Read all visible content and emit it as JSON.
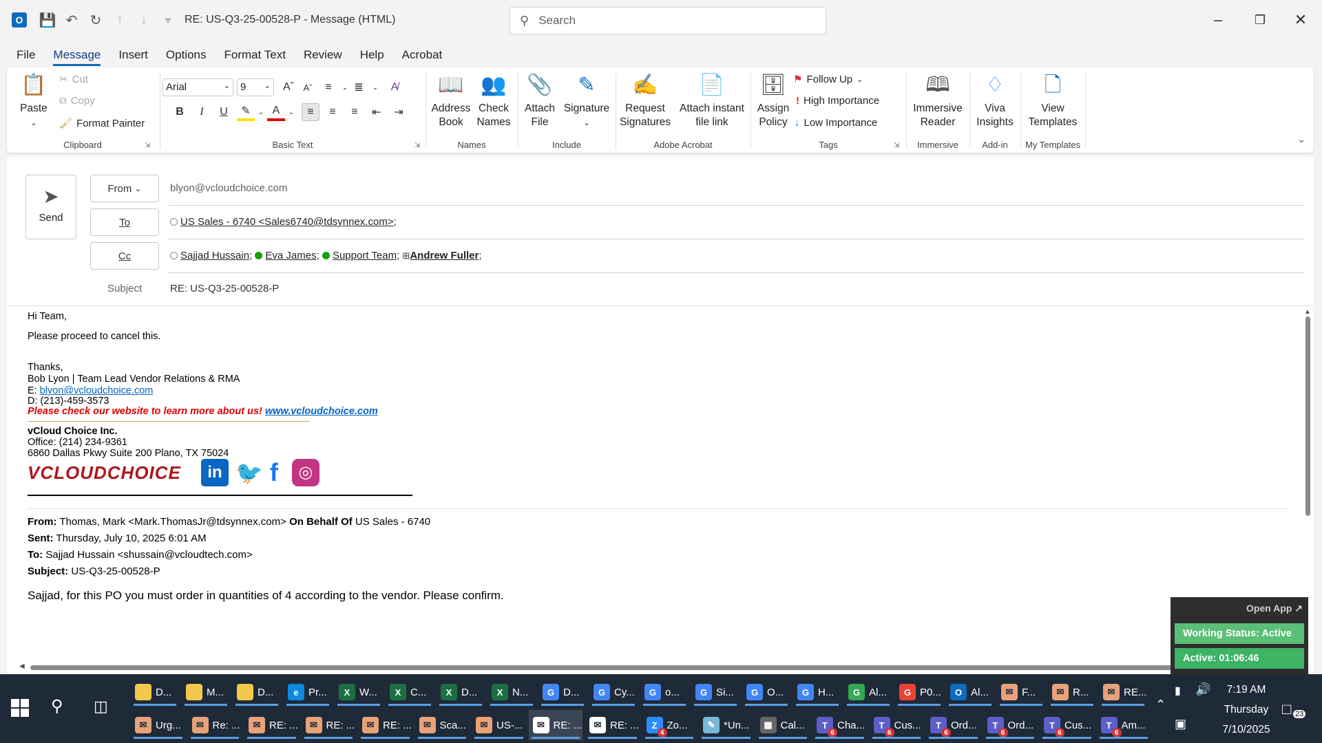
{
  "window": {
    "title": "RE: US-Q3-25-00528-P  -  Message (HTML)",
    "search_placeholder": "Search"
  },
  "menu": [
    "File",
    "Message",
    "Insert",
    "Options",
    "Format Text",
    "Review",
    "Help",
    "Acrobat"
  ],
  "ribbon": {
    "clipboard": {
      "paste": "Paste",
      "cut": "Cut",
      "copy": "Copy",
      "format_painter": "Format Painter",
      "label": "Clipboard"
    },
    "basic_text": {
      "font": "Arial",
      "size": "9",
      "label": "Basic Text"
    },
    "names": {
      "address_book": "Address Book",
      "check_names": "Check Names",
      "label": "Names"
    },
    "include": {
      "attach_file": "Attach File",
      "signature": "Signature",
      "label": "Include"
    },
    "adobe": {
      "request_signatures": "Request Signatures",
      "attach_link": "Attach instant file link",
      "label": "Adobe Acrobat"
    },
    "tags": {
      "assign_policy": "Assign Policy",
      "follow_up": "Follow Up",
      "high": "High Importance",
      "low": "Low Importance",
      "label": "Tags"
    },
    "immersive": {
      "reader": "Immersive Reader",
      "label": "Immersive"
    },
    "addin": {
      "viva": "Viva Insights",
      "label": "Add-in"
    },
    "templates": {
      "view": "View Templates",
      "label": "My Templates"
    }
  },
  "compose": {
    "send": "Send",
    "from_btn": "From",
    "from_value": "blyon@vcloudchoice.com",
    "to_btn": "To",
    "to_value": "US Sales - 6740 <Sales6740@tdsynnex.com>",
    "cc_btn": "Cc",
    "cc": [
      "Sajjad Hussain",
      "Eva James",
      "Support Team",
      "Andrew Fuller"
    ],
    "subject_label": "Subject",
    "subject_value": "RE: US-Q3-25-00528-P"
  },
  "body": {
    "greeting": "Hi Team,",
    "line1": "Please proceed to cancel this.",
    "thanks": "Thanks,",
    "sig_name": "Bob Lyon | Team Lead Vendor Relations & RMA",
    "sig_email_prefix": "E: ",
    "sig_email": "blyon@vcloudchoice.com",
    "sig_phone": "D: (213)-459-3573",
    "promo": "Please check our website to learn more about us!",
    "promo_link": "www.vcloudchoice.com",
    "company": "vCloud Choice Inc.",
    "office": "Office: (214) 234-9361",
    "address": "6860 Dallas Pkwy Suite 200 Plano, TX 75024",
    "logo_text": "VCLOUDCHOICE",
    "q_from_label": "From:",
    "q_from": "Thomas, Mark <Mark.ThomasJr@tdsynnex.com>",
    "q_behalf_label": "On Behalf Of",
    "q_behalf": "US Sales - 6740",
    "q_sent_label": "Sent:",
    "q_sent": "Thursday, July 10, 2025 6:01 AM",
    "q_to_label": "To:",
    "q_to": "Sajjad Hussain <shussain@vcloudtech.com>",
    "q_subject_label": "Subject:",
    "q_subject": "US-Q3-25-00528-P",
    "q_body": "Sajjad, for this PO you must order in quantities of 4 according to the vendor. Please confirm."
  },
  "widget": {
    "open_app": "Open App ↗",
    "status": "Working Status: Active",
    "active": "Active: 01:06:46"
  },
  "taskbar": {
    "row1": [
      {
        "label": "D...",
        "color": "#f2c94c",
        "icon": "folder"
      },
      {
        "label": "M...",
        "color": "#f2c94c",
        "icon": "folder"
      },
      {
        "label": "D...",
        "color": "#f2c94c",
        "icon": "folder"
      },
      {
        "label": "Pr...",
        "color": "#0c8ae0",
        "icon": "edge"
      },
      {
        "label": "W...",
        "color": "#1d6f42",
        "icon": "X"
      },
      {
        "label": "C...",
        "color": "#1d6f42",
        "icon": "X"
      },
      {
        "label": "D...",
        "color": "#1d6f42",
        "icon": "X"
      },
      {
        "label": "N...",
        "color": "#1d6f42",
        "icon": "X"
      },
      {
        "label": "D...",
        "color": "#4285f4",
        "icon": "chrome"
      },
      {
        "label": "Cy...",
        "color": "#4285f4",
        "icon": "chrome"
      },
      {
        "label": "o...",
        "color": "#4285f4",
        "icon": "chrome"
      },
      {
        "label": "Si...",
        "color": "#4285f4",
        "icon": "chrome"
      },
      {
        "label": "O...",
        "color": "#4285f4",
        "icon": "chrome"
      },
      {
        "label": "H...",
        "color": "#4285f4",
        "icon": "chrome"
      },
      {
        "label": "Al...",
        "color": "#34a853",
        "icon": "chrome"
      },
      {
        "label": "P0...",
        "color": "#ea4335",
        "icon": "chrome"
      },
      {
        "label": "Al...",
        "color": "#0f6cbd",
        "icon": "O"
      },
      {
        "label": "F...",
        "color": "#e8a27a",
        "icon": "mail"
      },
      {
        "label": "R...",
        "color": "#e8a27a",
        "icon": "mail"
      },
      {
        "label": "RE...",
        "color": "#e8a27a",
        "icon": "mail"
      }
    ],
    "row2": [
      {
        "label": "Urg...",
        "color": "#e8a27a",
        "icon": "mail"
      },
      {
        "label": "Re: ...",
        "color": "#e8a27a",
        "icon": "mail"
      },
      {
        "label": "RE: ...",
        "color": "#e8a27a",
        "icon": "mail"
      },
      {
        "label": "RE: ...",
        "color": "#e8a27a",
        "icon": "mail"
      },
      {
        "label": "RE: ...",
        "color": "#e8a27a",
        "icon": "mail"
      },
      {
        "label": "Sca...",
        "color": "#e8a27a",
        "icon": "mail"
      },
      {
        "label": "US-...",
        "color": "#e8a27a",
        "icon": "mail"
      },
      {
        "label": "RE: ...",
        "color": "#ffffff",
        "icon": "mail"
      },
      {
        "label": "RE: ...",
        "color": "#ffffff",
        "icon": "mail"
      },
      {
        "label": "Zo...",
        "color": "#2d8cff",
        "icon": "zoom",
        "badge": "4"
      },
      {
        "label": "*Un...",
        "color": "#7ab8d8",
        "icon": "notepad"
      },
      {
        "label": "Cal...",
        "color": "#666666",
        "icon": "calc"
      },
      {
        "label": "Cha...",
        "color": "#5b5fc7",
        "icon": "T",
        "badge": "6"
      },
      {
        "label": "Cus...",
        "color": "#5b5fc7",
        "icon": "T",
        "badge": "6"
      },
      {
        "label": "Ord...",
        "color": "#5b5fc7",
        "icon": "T",
        "badge": "6"
      },
      {
        "label": "Ord...",
        "color": "#5b5fc7",
        "icon": "T",
        "badge": "6"
      },
      {
        "label": "Cus...",
        "color": "#5b5fc7",
        "icon": "T",
        "badge": "6"
      },
      {
        "label": "Am...",
        "color": "#5b5fc7",
        "icon": "T",
        "badge": "6"
      }
    ],
    "time": "7:19 AM",
    "day": "Thursday",
    "date": "7/10/2025",
    "notifications": "23"
  }
}
